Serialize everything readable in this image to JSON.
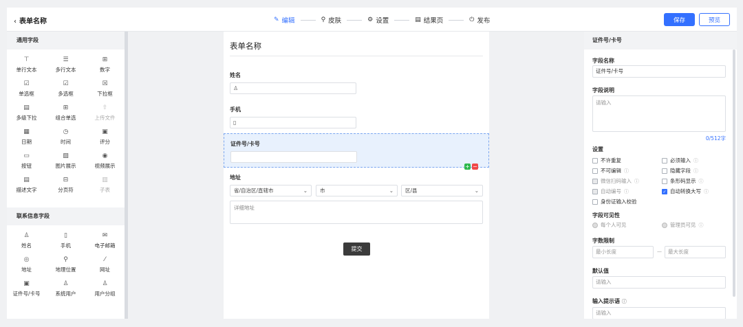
{
  "header": {
    "back_label": "表单名称",
    "steps": [
      "编辑",
      "皮肤",
      "设置",
      "结果页",
      "发布"
    ],
    "save": "保存",
    "preview": "预览"
  },
  "left": {
    "general_title": "通用字段",
    "general": [
      {
        "icon": "text-icon",
        "glyph": "⊤",
        "label": "单行文本",
        "disabled": false
      },
      {
        "icon": "multiline-icon",
        "glyph": "☰",
        "label": "多行文本",
        "disabled": false
      },
      {
        "icon": "number-icon",
        "glyph": "⊞",
        "label": "数字",
        "disabled": false
      },
      {
        "icon": "radio-icon",
        "glyph": "☑",
        "label": "单选框",
        "disabled": false
      },
      {
        "icon": "checkbox-icon",
        "glyph": "☑",
        "label": "多选框",
        "disabled": false
      },
      {
        "icon": "dropdown-icon",
        "glyph": "☒",
        "label": "下拉框",
        "disabled": false
      },
      {
        "icon": "cascade-icon",
        "glyph": "▤",
        "label": "多级下拉",
        "disabled": false
      },
      {
        "icon": "combo-icon",
        "glyph": "⊞",
        "label": "组合单选",
        "disabled": false
      },
      {
        "icon": "upload-icon",
        "glyph": "⇧",
        "label": "上传文件",
        "disabled": true
      },
      {
        "icon": "date-icon",
        "glyph": "▦",
        "label": "日期",
        "disabled": false
      },
      {
        "icon": "time-icon",
        "glyph": "◷",
        "label": "时间",
        "disabled": false
      },
      {
        "icon": "rating-icon",
        "glyph": "▣",
        "label": "评分",
        "disabled": false
      },
      {
        "icon": "button-icon",
        "glyph": "▭",
        "label": "按钮",
        "disabled": false
      },
      {
        "icon": "image-icon",
        "glyph": "▨",
        "label": "图片展示",
        "disabled": false
      },
      {
        "icon": "video-icon",
        "glyph": "◉",
        "label": "视频展示",
        "disabled": false
      },
      {
        "icon": "desc-icon",
        "glyph": "▤",
        "label": "描述文字",
        "disabled": false
      },
      {
        "icon": "pager-icon",
        "glyph": "⊟",
        "label": "分页符",
        "disabled": false
      },
      {
        "icon": "subtable-icon",
        "glyph": "▥",
        "label": "子表",
        "disabled": true
      }
    ],
    "contact_title": "联系信息字段",
    "contact": [
      {
        "icon": "person-icon",
        "glyph": "♙",
        "label": "姓名"
      },
      {
        "icon": "phone-icon",
        "glyph": "▯",
        "label": "手机"
      },
      {
        "icon": "mail-icon",
        "glyph": "✉",
        "label": "电子邮箱"
      },
      {
        "icon": "address-icon",
        "glyph": "◎",
        "label": "地址"
      },
      {
        "icon": "location-icon",
        "glyph": "⚲",
        "label": "地理位置"
      },
      {
        "icon": "link-icon",
        "glyph": "⁄",
        "label": "网址"
      },
      {
        "icon": "idcard-icon",
        "glyph": "▣",
        "label": "证件号/卡号"
      },
      {
        "icon": "sysuser-icon",
        "glyph": "♙",
        "label": "系统用户"
      },
      {
        "icon": "group-icon",
        "glyph": "♙",
        "label": "用户分组"
      }
    ]
  },
  "form": {
    "title": "表单名称",
    "name_label": "姓名",
    "phone_label": "手机",
    "id_label": "证件号/卡号",
    "address_label": "地址",
    "province": "省/自治区/直辖市",
    "city": "市",
    "district": "区/县",
    "detail_placeholder": "详细地址",
    "submit": "提交"
  },
  "panel": {
    "title": "证件号/卡号",
    "name_label": "字段名称",
    "name_value": "证件号/卡号",
    "desc_label": "字段说明",
    "desc_placeholder": "请输入",
    "desc_count": "0/512字",
    "settings_label": "设置",
    "options": [
      {
        "label": "不许重复",
        "checked": false,
        "disabled": false,
        "help": false
      },
      {
        "label": "必须输入",
        "checked": false,
        "disabled": false,
        "help": true
      },
      {
        "label": "不可编辑",
        "checked": false,
        "disabled": false,
        "help": true
      },
      {
        "label": "隐藏字段",
        "checked": false,
        "disabled": false,
        "help": true
      },
      {
        "label": "微信扫码输入",
        "checked": false,
        "disabled": true,
        "help": true
      },
      {
        "label": "条形码显示",
        "checked": false,
        "disabled": false,
        "help": true
      },
      {
        "label": "自动编号",
        "checked": false,
        "disabled": true,
        "help": true
      },
      {
        "label": "自动转换大写",
        "checked": true,
        "disabled": false,
        "help": true
      },
      {
        "label": "身份证输入校验",
        "checked": false,
        "disabled": false,
        "help": false
      }
    ],
    "visibility_label": "字段可见性",
    "vis_all": "每个人可见",
    "vis_admin": "管理员可见",
    "limit_label": "字数限制",
    "min_placeholder": "最小长度",
    "max_placeholder": "最大长度",
    "dash": "—",
    "default_label": "默认值",
    "default_placeholder": "请输入",
    "hint_label": "输入提示语",
    "hint_placeholder": "请输入"
  },
  "colors": {
    "accent": "#3370ff",
    "add": "#2db84d",
    "remove": "#f04848"
  }
}
